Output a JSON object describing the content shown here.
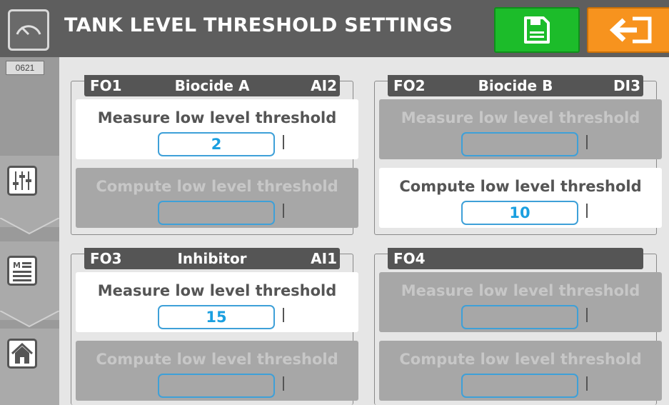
{
  "header": {
    "title": "TANK LEVEL THRESHOLD SETTINGS",
    "left_icon": "gauge-icon",
    "save_icon": "save-icon",
    "exit_icon": "exit-icon",
    "colors": {
      "bar": "#5e5e5e",
      "save": "#1cbc2a",
      "exit": "#f7931e"
    }
  },
  "sidebar": {
    "counter": "0621",
    "buttons": [
      {
        "icon": "sliders-icon"
      },
      {
        "icon": "list-icon"
      },
      {
        "icon": "home-icon"
      }
    ]
  },
  "sections": [
    {
      "id": "FO1",
      "name": "Biocide A",
      "input": "AI2",
      "measure": {
        "label": "Measure low level threshold",
        "value": "2",
        "enabled": true
      },
      "compute": {
        "label": "Compute low level threshold",
        "value": "",
        "enabled": false
      }
    },
    {
      "id": "FO2",
      "name": "Biocide B",
      "input": "DI3",
      "measure": {
        "label": "Measure low level threshold",
        "value": "",
        "enabled": false
      },
      "compute": {
        "label": "Compute low level threshold",
        "value": "10",
        "enabled": true
      }
    },
    {
      "id": "FO3",
      "name": "Inhibitor",
      "input": "AI1",
      "measure": {
        "label": "Measure low level threshold",
        "value": "15",
        "enabled": true
      },
      "compute": {
        "label": "Compute low level threshold",
        "value": "",
        "enabled": false
      }
    },
    {
      "id": "FO4",
      "name": "",
      "input": "",
      "measure": {
        "label": "Measure low level threshold",
        "value": "",
        "enabled": false
      },
      "compute": {
        "label": "Compute low level threshold",
        "value": "",
        "enabled": false
      }
    }
  ]
}
